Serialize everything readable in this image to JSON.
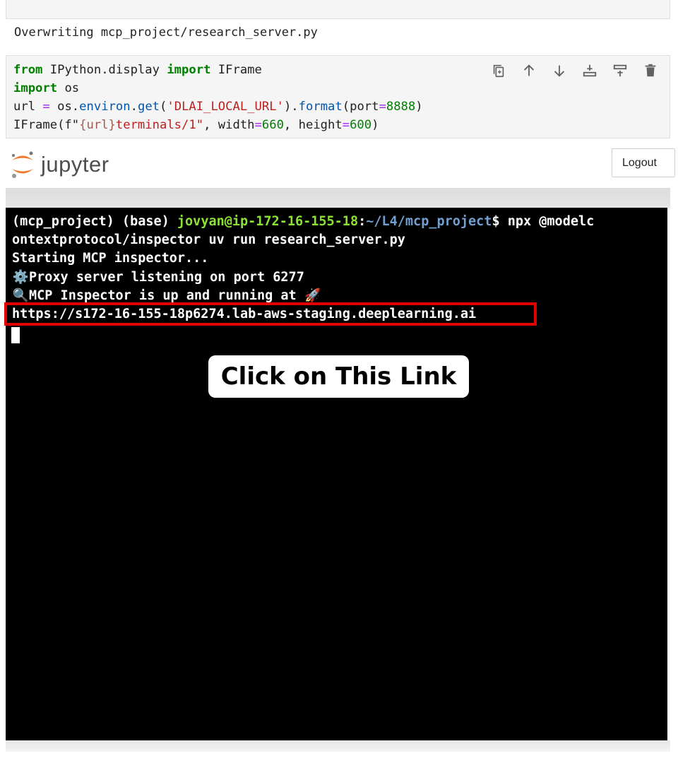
{
  "output": {
    "overwriting": "Overwriting mcp_project/research_server.py"
  },
  "code": {
    "line1": {
      "kw1": "from",
      "mod": " IPython.display ",
      "kw2": "import",
      "name": " IFrame"
    },
    "line2": {
      "kw": "import",
      "name": " os"
    },
    "line3": {
      "a": "url ",
      "eq": "=",
      "b": " os.",
      "c": "environ",
      "d": ".",
      "e": "get",
      "f": "(",
      "str": "'DLAI_LOCAL_URL'",
      "g": ").",
      "h": "format",
      "i": "(port",
      "eq2": "=",
      "num": "8888",
      "j": ")"
    },
    "line4": {
      "a": "IFrame(f\"",
      "b": "{url}",
      "c": "terminals/1\"",
      "d": ", width",
      "eq": "=",
      "num1": "660",
      "e": ", height",
      "eq2": "=",
      "num2": "600",
      "f": ")"
    }
  },
  "cell_toolbar": {
    "icons": [
      "copy-icon",
      "move-up-icon",
      "move-down-icon",
      "insert-below-icon",
      "insert-above-icon",
      "delete-icon"
    ]
  },
  "header": {
    "logo_text": "jupyter",
    "logout_label": "Logout"
  },
  "terminal": {
    "prompt_env": "(mcp_project) (base) ",
    "prompt_user": "jovyan@ip-172-16-155-18",
    "prompt_colon": ":",
    "prompt_path": "~/L4/mcp_project",
    "prompt_cmd": "$ npx @modelc",
    "line2": "ontextprotocol/inspector uv run research_server.py",
    "line3": "Starting MCP inspector...",
    "line4_icon": "⚙️",
    "line4": "Proxy server listening on port 6277",
    "line5_icon": "🔍",
    "line5": "MCP Inspector is up and running at ",
    "line5_icon2": "🚀",
    "url": "https://s172-16-155-18p6274.lab-aws-staging.deeplearning.ai"
  },
  "callout": {
    "text": "Click on This Link"
  },
  "colors": {
    "highlight": "#e00000",
    "prompt_user": "#8ae234",
    "prompt_path": "#729fcf",
    "logo_orange": "#f37726"
  }
}
